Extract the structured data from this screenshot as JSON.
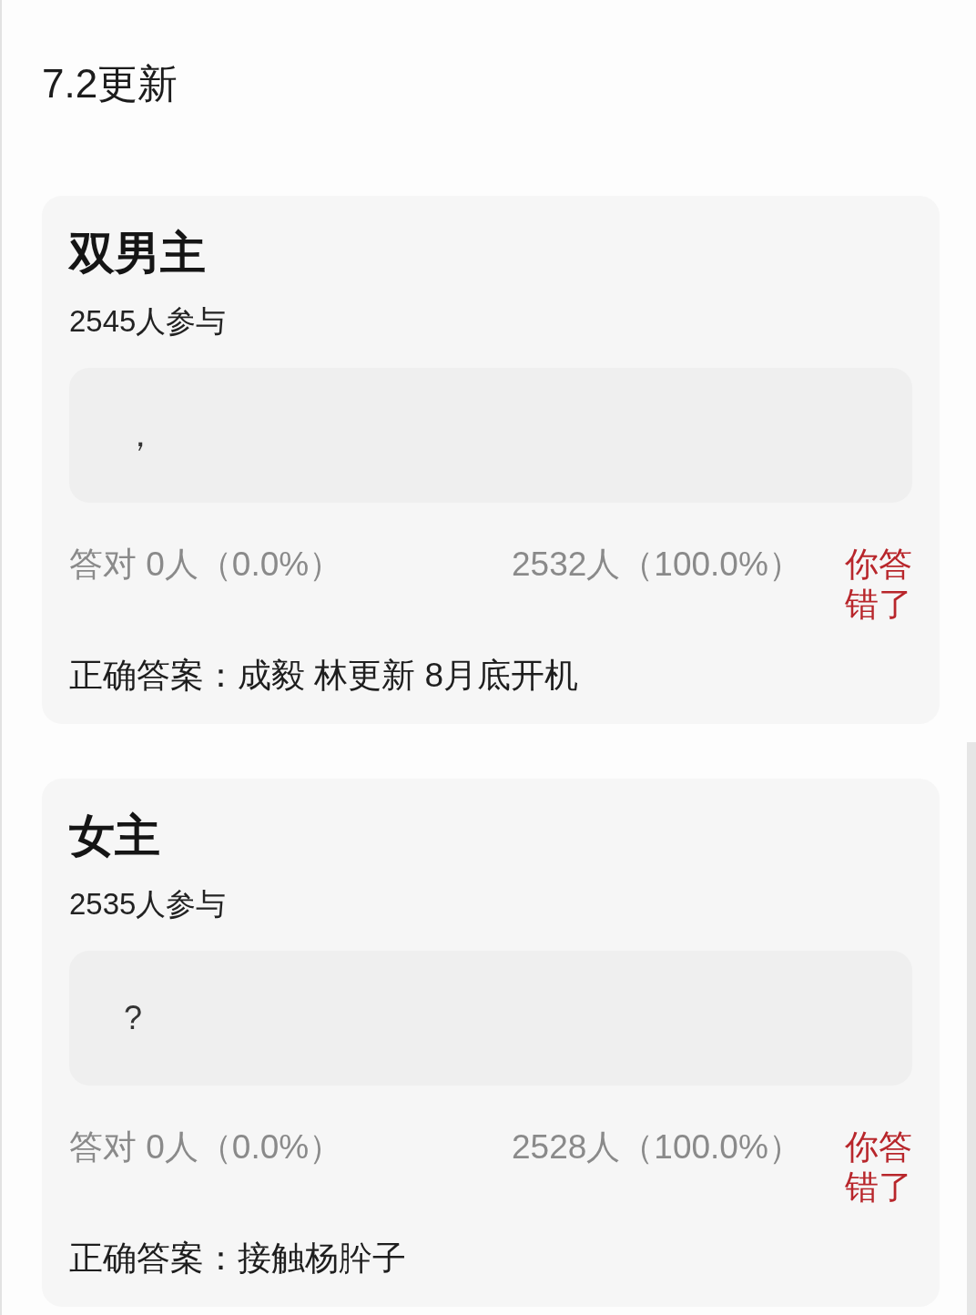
{
  "title": "7.2更新",
  "polls": [
    {
      "question": "双男主",
      "participants": "2545人参与",
      "your_answer": "，",
      "correct_stat": "答对 0人（0.0%）",
      "other_stat": "2532人（100.0%）",
      "result": {
        "text": "你答错了",
        "correct": false
      },
      "correct_answer": "正确答案：成毅 林更新 8月底开机"
    },
    {
      "question": "女主",
      "participants": "2535人参与",
      "your_answer": "?",
      "correct_stat": "答对 0人（0.0%）",
      "other_stat": "2528人（100.0%）",
      "result": {
        "text": "你答错了",
        "correct": false
      },
      "correct_answer": "正确答案：接触杨肸子"
    }
  ]
}
